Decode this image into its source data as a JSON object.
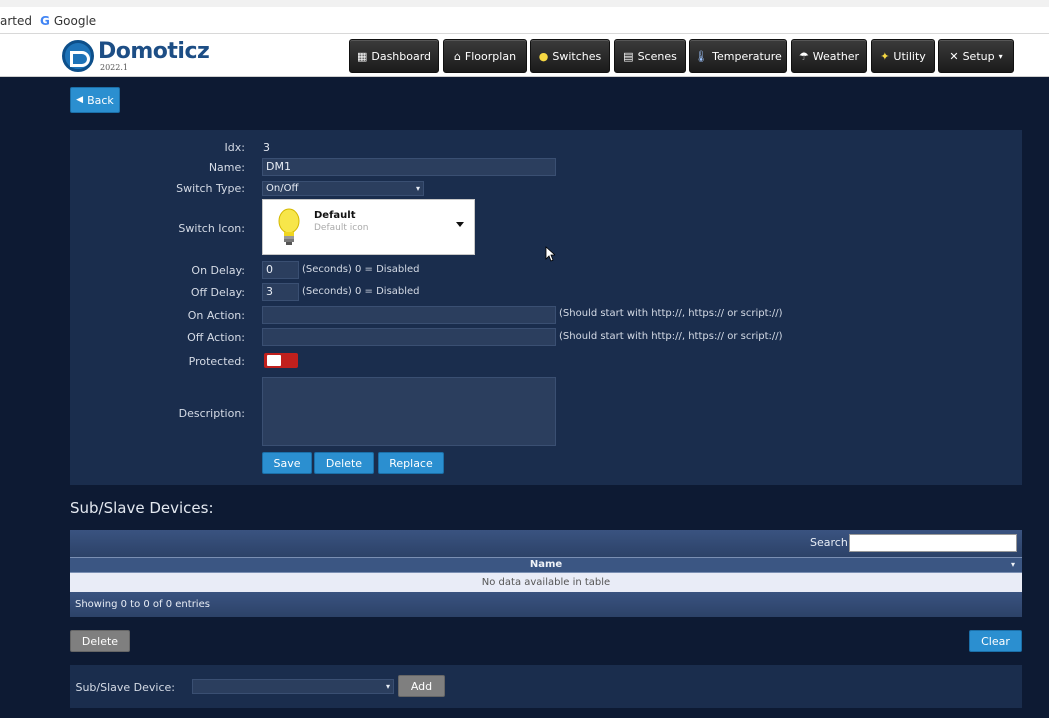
{
  "browser": {
    "bookmarks": [
      "arted",
      "Google"
    ]
  },
  "header": {
    "logo_name": "Domoticz",
    "logo_version": "2022.1",
    "nav": [
      {
        "label": "Dashboard",
        "icon": "dashboard-icon"
      },
      {
        "label": "Floorplan",
        "icon": "floorplan-icon"
      },
      {
        "label": "Switches",
        "icon": "lightbulb-icon"
      },
      {
        "label": "Scenes",
        "icon": "scenes-icon"
      },
      {
        "label": "Temperature",
        "icon": "thermometer-icon"
      },
      {
        "label": "Weather",
        "icon": "weather-icon"
      },
      {
        "label": "Utility",
        "icon": "utility-icon"
      },
      {
        "label": "Setup",
        "icon": "tools-icon"
      }
    ]
  },
  "back_label": "Back",
  "form": {
    "idx_label": "Idx:",
    "idx_value": "3",
    "name_label": "Name:",
    "name_value": "DM1",
    "switch_type_label": "Switch Type:",
    "switch_type_value": "On/Off",
    "switch_icon_label": "Switch Icon:",
    "icon_title": "Default",
    "icon_sub": "Default icon",
    "on_delay_label": "On Delay:",
    "on_delay_value": "0",
    "on_delay_hint": "(Seconds) 0 = Disabled",
    "off_delay_label": "Off Delay:",
    "off_delay_value": "3",
    "off_delay_hint": "(Seconds) 0 = Disabled",
    "on_action_label": "On Action:",
    "on_action_hint": "(Should start with http://, https:// or script://)",
    "off_action_label": "Off Action:",
    "off_action_hint": "(Should start with http://, https:// or script://)",
    "protected_label": "Protected:",
    "description_label": "Description:",
    "save_label": "Save",
    "delete_label": "Delete",
    "replace_label": "Replace"
  },
  "subslave": {
    "title": "Sub/Slave Devices:",
    "search_label": "Search:",
    "column_name": "Name",
    "empty_text": "No data available in table",
    "footer_text": "Showing 0 to 0 of 0 entries",
    "delete_label": "Delete",
    "clear_label": "Clear",
    "device_label": "Sub/Slave Device:",
    "add_label": "Add"
  },
  "colors": {
    "accent": "#2b8fd0",
    "toggle_on": "#c0201d",
    "page_bg": "#0d1a33",
    "panel_bg": "#1a2d4d"
  }
}
